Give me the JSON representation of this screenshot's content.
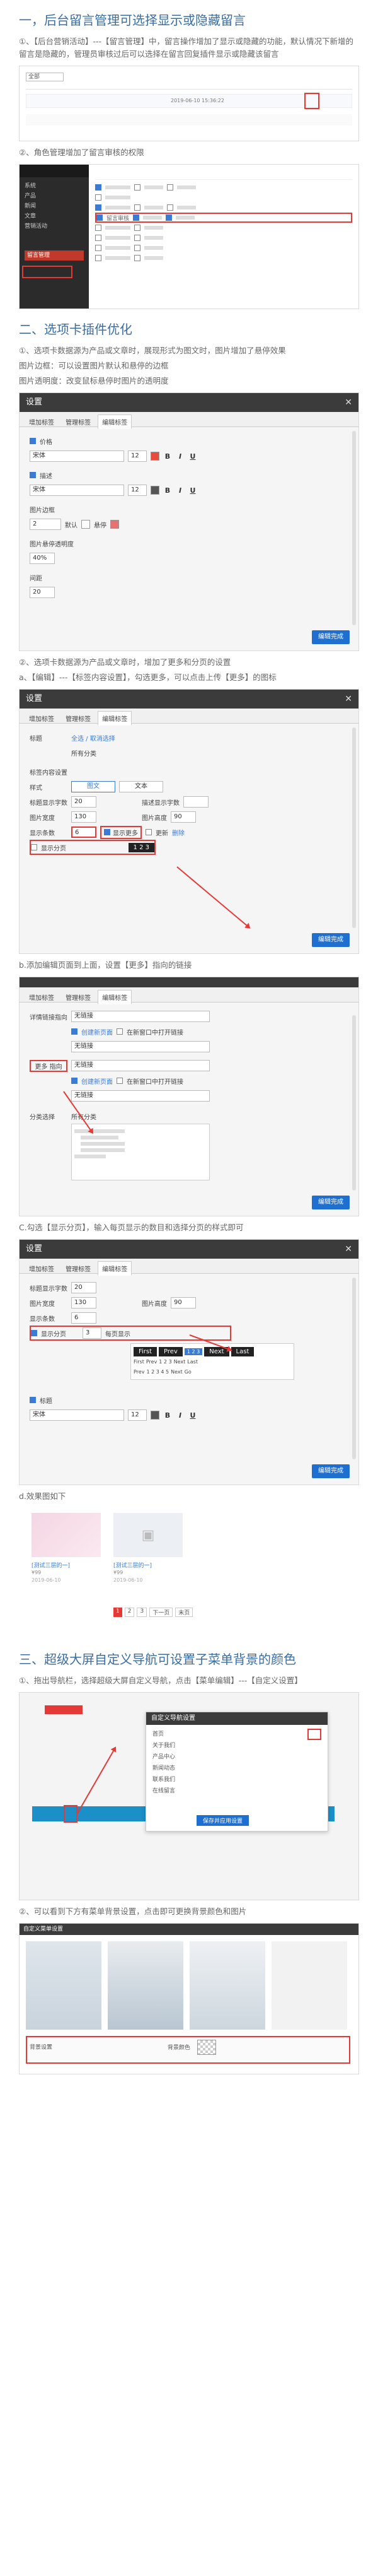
{
  "s1": {
    "title": "一，后台留言管理可选择显示或隐藏留言",
    "p1": "①、【后台营销活动】---【留言管理】中，留言操作增加了显示或隐藏的功能，默认情况下新增的留言是隐藏的，管理员审核过后可以选择在留言回复插件显示或隐藏该留言",
    "shot1_header": "全部",
    "shot1_date": "2019-06-10 15:36:22",
    "p2": "②、角色管理增加了留言审核的权限",
    "shot2_items": [
      "系统",
      "产品",
      "新闻",
      "文章",
      "营销活动",
      "留言管理"
    ],
    "shot2_highlight": "留言审核"
  },
  "s2": {
    "title": "二、选项卡插件优化",
    "p1": "①、选项卡数据源为产品或文章时，展现形式为图文时，图片增加了悬停效果",
    "p2": "图片边框：可以设置图片默认和悬停的边框",
    "p3": "图片透明度：改变鼠标悬停时图片的透明度",
    "dlg1": {
      "title": "设置",
      "tabs": [
        "增加标签",
        "管理标签",
        "编辑标签"
      ],
      "price": "价格",
      "desc": "描述",
      "font": "宋体",
      "size": "12",
      "border": "图片边框",
      "border_val": "2",
      "default": "默认",
      "hover": "悬停",
      "opacity": "图片悬停透明度",
      "opacity_val": "40%",
      "spacing": "间距",
      "spacing_val": "20",
      "save": "编辑完成"
    },
    "p4": "②、选项卡数据源为产品或文章时，增加了更多和分页的设置",
    "p5": "a、【编辑】---【标签内容设置】，勾选更多，可以点击上传【更多】的图标",
    "dlg2": {
      "title": "设置",
      "tabs": [
        "增加标签",
        "管理标签",
        "编辑标签"
      ],
      "label": "标题",
      "label_link": "全选 / 取消选择",
      "all": "所有分类",
      "content": "标签内容设置",
      "style": "样式",
      "style_a": "图文",
      "style_b": "文本",
      "title_len": "标题显示字数",
      "title_len_val": "20",
      "desc_len": "描述显示字数",
      "img_w": "图片宽度",
      "img_w_val": "130",
      "img_h": "图片高度",
      "img_h_val": "90",
      "count": "显示条数",
      "count_val": "6",
      "more": "显示更多",
      "paging": "显示分页",
      "update": "更新",
      "reset": "删除",
      "save": "编辑完成"
    },
    "p6": "b.添加编辑页面到上面，设置【更多】指向的链接",
    "dlg3": {
      "tabs": [
        "增加标签",
        "管理标签",
        "编辑标签"
      ],
      "detail_link": "详情链接指向",
      "none": "无链接",
      "new_window": "创建新页面",
      "open_new": "在新窗口中打开链接",
      "more_link": "更多 指向",
      "category": "分类选择",
      "all_cat": "所有分类",
      "save": "编辑完成"
    },
    "p7": "C.勾选【显示分页】，输入每页显示的数目和选择分页的样式即可",
    "dlg4": {
      "title": "设置",
      "tabs": [
        "增加标签",
        "管理标签",
        "编辑标签"
      ],
      "title_len": "标题显示字数",
      "title_len_val": "20",
      "img_w": "图片宽度",
      "img_w_val": "130",
      "img_h": "图片高度",
      "img_h_val": "90",
      "count": "显示条数",
      "count_val": "6",
      "paging": "显示分页",
      "per_page": "每页显示",
      "per_val": "3",
      "first": "First",
      "prev": "Prev",
      "next": "Next",
      "last": "Last",
      "go": "Go",
      "label": "标题",
      "font": "宋体",
      "size": "12",
      "save": "编辑完成"
    },
    "p8": "d.效果图如下",
    "demo": {
      "item_title": "[测试三层的一]",
      "item_price": "¥99",
      "date": "2019-06-10",
      "pages": [
        "1",
        "2",
        "3"
      ],
      "next": "下一页",
      "last": "末页"
    }
  },
  "s3": {
    "title": "三、超级大屏自定义导航可设置子菜单背景的颜色",
    "p1": "①、拖出导航栏，选择超级大屏自定义导航，点击【菜单编辑】---【自定义设置】",
    "nav_dialog": "自定义导航设置",
    "nav_items": [
      "首页",
      "关于我们",
      "产品中心",
      "新闻动态",
      "联系我们",
      "在线留言"
    ],
    "nav_save": "保存并应用设置",
    "p2": "②、可以看到下方有菜单背景设置，点击即可更换背景颜色和图片",
    "menu_title": "自定义菜单设置",
    "bg": "背景设置",
    "bg_color": "背景颜色"
  },
  "colors": {
    "title": "#3a6ea5",
    "red": "#e53935",
    "accent": "#1f6fd1",
    "dark": "#3b3b3b"
  }
}
